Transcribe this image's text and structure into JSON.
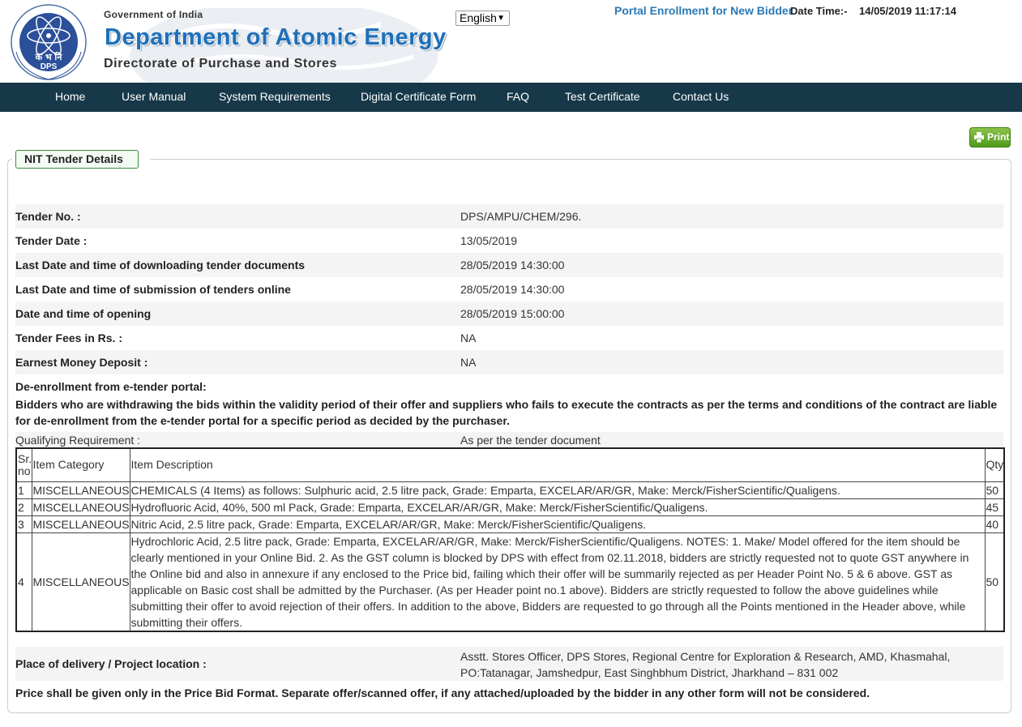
{
  "header": {
    "logo_text": "क भ नि DPS",
    "logo_ring_text": "ATOMS IN THE SERVICE OF THE NATION",
    "gov": "Government of India",
    "dept": "Department of Atomic Energy",
    "directorate": "Directorate of Purchase and Stores",
    "language": "English",
    "enroll_link": "Portal Enrollment for New Bidder",
    "datetime_label": "Date Time:-",
    "datetime_value": "14/05/2019 11:17:14"
  },
  "nav": [
    {
      "label": "Home"
    },
    {
      "label": "User Manual"
    },
    {
      "label": "System Requirements"
    },
    {
      "label": "Digital Certificate Form"
    },
    {
      "label": "FAQ"
    },
    {
      "label": "Test Certificate"
    },
    {
      "label": "Contact Us"
    }
  ],
  "print_label": "Print",
  "panel_title": "NIT Tender Details",
  "details": [
    {
      "label": "Tender No. :",
      "value": "DPS/AMPU/CHEM/296."
    },
    {
      "label": "Tender Date :",
      "value": "13/05/2019"
    },
    {
      "label": "Last Date and time of downloading tender documents",
      "value": "28/05/2019 14:30:00"
    },
    {
      "label": "Last Date and time of submission of tenders online",
      "value": "28/05/2019 14:30:00"
    },
    {
      "label": "Date and time of opening",
      "value": "28/05/2019 15:00:00"
    },
    {
      "label": "Tender Fees in Rs. :",
      "value": "NA"
    },
    {
      "label": "Earnest Money Deposit :",
      "value": "NA"
    }
  ],
  "deenrollment": {
    "title": "De-enrollment from e-tender portal:",
    "text": "Bidders who are withdrawing the bids within the validity period of their offer and suppliers who fails to execute the contracts as per the terms and conditions of the contract are liable for de-enrollment from the e-tender portal for a specific period as decided by the purchaser."
  },
  "qualifying": {
    "label": "Qualifying Requirement :",
    "value": "As per the tender document"
  },
  "items_table": {
    "headers": {
      "sr": "Sr. no",
      "category": "Item Category",
      "description": "Item Description",
      "qty": "Qty"
    },
    "rows": [
      {
        "sr": "1",
        "category": "MISCELLANEOUS",
        "description": "CHEMICALS (4 Items) as follows: Sulphuric acid, 2.5 litre pack, Grade: Emparta, EXCELAR/AR/GR, Make: Merck/FisherScientific/Qualigens.",
        "qty": "50"
      },
      {
        "sr": "2",
        "category": "MISCELLANEOUS",
        "description": "Hydrofluoric Acid, 40%, 500 ml Pack, Grade: Emparta, EXCELAR/AR/GR, Make: Merck/FisherScientific/Qualigens.",
        "qty": "45"
      },
      {
        "sr": "3",
        "category": "MISCELLANEOUS",
        "description": "Nitric Acid, 2.5 litre pack, Grade: Emparta, EXCELAR/AR/GR, Make: Merck/FisherScientific/Qualigens.",
        "qty": "40"
      },
      {
        "sr": "4",
        "category": "MISCELLANEOUS",
        "description": "Hydrochloric Acid, 2.5 litre pack, Grade: Emparta, EXCELAR/AR/GR, Make: Merck/FisherScientific/Qualigens. NOTES: 1. Make/ Model offered for the item should be clearly mentioned in your Online Bid. 2. As the GST column is blocked by DPS with effect from 02.11.2018, bidders are strictly requested not to quote GST anywhere in the Online bid and also in annexure if any enclosed to the Price bid, failing which their offer will be summarily rejected as per Header Point No. 5 & 6 above. GST as applicable on Basic cost shall be admitted by the Purchaser. (As per Header point no.1 above). Bidders are strictly requested to follow the above guidelines while submitting their offer to avoid rejection of their offers. In addition to the above, Bidders are requested to go through all the Points mentioned in the Header above, while submitting their offers.",
        "qty": "50"
      }
    ]
  },
  "delivery": {
    "label": "Place of delivery / Project location :",
    "value": "Asstt. Stores Officer, DPS Stores, Regional Centre for Exploration & Research, AMD, Khasmahal, PO:Tatanagar, Jamshedpur, East Singhbhum District, Jharkhand – 831 002"
  },
  "price_note": "Price shall be given only in the Price Bid Format. Separate offer/scanned offer, if any attached/uploaded by the bidder in any other form will not be considered.",
  "colors": {
    "nav_bg": "#163849",
    "dept_blue": "#1f6fb8",
    "link_blue": "#2b79b5",
    "print_green": "#5ea325"
  }
}
